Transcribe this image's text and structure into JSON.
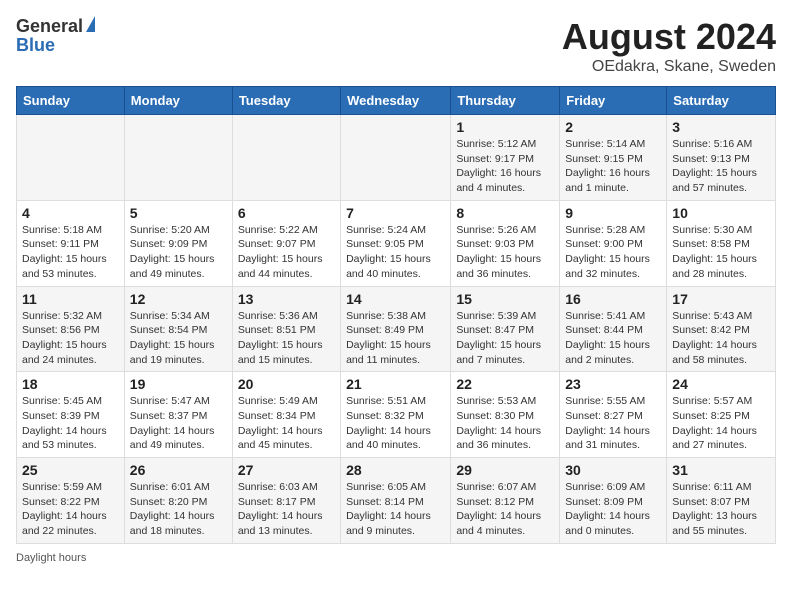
{
  "logo": {
    "line1": "General",
    "line2": "Blue"
  },
  "title": "August 2024",
  "subtitle": "OEdakra, Skane, Sweden",
  "weekdays": [
    "Sunday",
    "Monday",
    "Tuesday",
    "Wednesday",
    "Thursday",
    "Friday",
    "Saturday"
  ],
  "weeks": [
    [
      null,
      null,
      null,
      null,
      {
        "day": "1",
        "sunrise": "5:12 AM",
        "sunset": "9:17 PM",
        "daylight": "16 hours and 4 minutes."
      },
      {
        "day": "2",
        "sunrise": "5:14 AM",
        "sunset": "9:15 PM",
        "daylight": "16 hours and 1 minute."
      },
      {
        "day": "3",
        "sunrise": "5:16 AM",
        "sunset": "9:13 PM",
        "daylight": "15 hours and 57 minutes."
      }
    ],
    [
      {
        "day": "4",
        "sunrise": "5:18 AM",
        "sunset": "9:11 PM",
        "daylight": "15 hours and 53 minutes."
      },
      {
        "day": "5",
        "sunrise": "5:20 AM",
        "sunset": "9:09 PM",
        "daylight": "15 hours and 49 minutes."
      },
      {
        "day": "6",
        "sunrise": "5:22 AM",
        "sunset": "9:07 PM",
        "daylight": "15 hours and 44 minutes."
      },
      {
        "day": "7",
        "sunrise": "5:24 AM",
        "sunset": "9:05 PM",
        "daylight": "15 hours and 40 minutes."
      },
      {
        "day": "8",
        "sunrise": "5:26 AM",
        "sunset": "9:03 PM",
        "daylight": "15 hours and 36 minutes."
      },
      {
        "day": "9",
        "sunrise": "5:28 AM",
        "sunset": "9:00 PM",
        "daylight": "15 hours and 32 minutes."
      },
      {
        "day": "10",
        "sunrise": "5:30 AM",
        "sunset": "8:58 PM",
        "daylight": "15 hours and 28 minutes."
      }
    ],
    [
      {
        "day": "11",
        "sunrise": "5:32 AM",
        "sunset": "8:56 PM",
        "daylight": "15 hours and 24 minutes."
      },
      {
        "day": "12",
        "sunrise": "5:34 AM",
        "sunset": "8:54 PM",
        "daylight": "15 hours and 19 minutes."
      },
      {
        "day": "13",
        "sunrise": "5:36 AM",
        "sunset": "8:51 PM",
        "daylight": "15 hours and 15 minutes."
      },
      {
        "day": "14",
        "sunrise": "5:38 AM",
        "sunset": "8:49 PM",
        "daylight": "15 hours and 11 minutes."
      },
      {
        "day": "15",
        "sunrise": "5:39 AM",
        "sunset": "8:47 PM",
        "daylight": "15 hours and 7 minutes."
      },
      {
        "day": "16",
        "sunrise": "5:41 AM",
        "sunset": "8:44 PM",
        "daylight": "15 hours and 2 minutes."
      },
      {
        "day": "17",
        "sunrise": "5:43 AM",
        "sunset": "8:42 PM",
        "daylight": "14 hours and 58 minutes."
      }
    ],
    [
      {
        "day": "18",
        "sunrise": "5:45 AM",
        "sunset": "8:39 PM",
        "daylight": "14 hours and 53 minutes."
      },
      {
        "day": "19",
        "sunrise": "5:47 AM",
        "sunset": "8:37 PM",
        "daylight": "14 hours and 49 minutes."
      },
      {
        "day": "20",
        "sunrise": "5:49 AM",
        "sunset": "8:34 PM",
        "daylight": "14 hours and 45 minutes."
      },
      {
        "day": "21",
        "sunrise": "5:51 AM",
        "sunset": "8:32 PM",
        "daylight": "14 hours and 40 minutes."
      },
      {
        "day": "22",
        "sunrise": "5:53 AM",
        "sunset": "8:30 PM",
        "daylight": "14 hours and 36 minutes."
      },
      {
        "day": "23",
        "sunrise": "5:55 AM",
        "sunset": "8:27 PM",
        "daylight": "14 hours and 31 minutes."
      },
      {
        "day": "24",
        "sunrise": "5:57 AM",
        "sunset": "8:25 PM",
        "daylight": "14 hours and 27 minutes."
      }
    ],
    [
      {
        "day": "25",
        "sunrise": "5:59 AM",
        "sunset": "8:22 PM",
        "daylight": "14 hours and 22 minutes."
      },
      {
        "day": "26",
        "sunrise": "6:01 AM",
        "sunset": "8:20 PM",
        "daylight": "14 hours and 18 minutes."
      },
      {
        "day": "27",
        "sunrise": "6:03 AM",
        "sunset": "8:17 PM",
        "daylight": "14 hours and 13 minutes."
      },
      {
        "day": "28",
        "sunrise": "6:05 AM",
        "sunset": "8:14 PM",
        "daylight": "14 hours and 9 minutes."
      },
      {
        "day": "29",
        "sunrise": "6:07 AM",
        "sunset": "8:12 PM",
        "daylight": "14 hours and 4 minutes."
      },
      {
        "day": "30",
        "sunrise": "6:09 AM",
        "sunset": "8:09 PM",
        "daylight": "14 hours and 0 minutes."
      },
      {
        "day": "31",
        "sunrise": "6:11 AM",
        "sunset": "8:07 PM",
        "daylight": "13 hours and 55 minutes."
      }
    ]
  ],
  "footer": "Daylight hours"
}
